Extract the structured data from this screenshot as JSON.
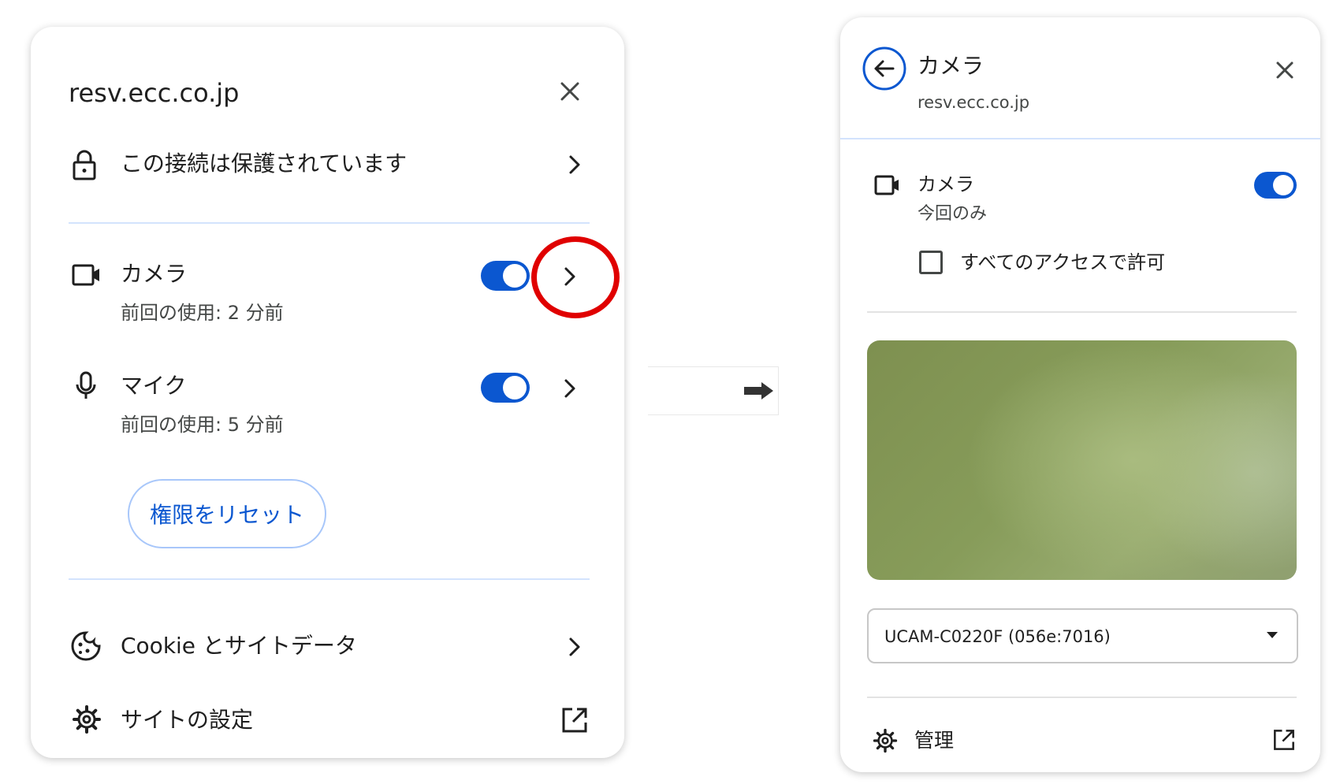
{
  "left": {
    "site": "resv.ecc.co.jp",
    "connection": "この接続は保護されています",
    "camera": {
      "label": "カメラ",
      "status": "前回の使用: 2 分前",
      "enabled": true
    },
    "mic": {
      "label": "マイク",
      "status": "前回の使用: 5 分前",
      "enabled": true
    },
    "reset_button": "権限をリセット",
    "cookies": "Cookie とサイトデータ",
    "site_settings": "サイトの設定"
  },
  "right": {
    "title": "カメラ",
    "site": "resv.ecc.co.jp",
    "camera": {
      "label": "カメラ",
      "status": "今回のみ",
      "enabled": true
    },
    "allow_all_label": "すべてのアクセスで許可",
    "allow_all_checked": false,
    "device": "UCAM-C0220F (056e:7016)",
    "manage": "管理"
  },
  "colors": {
    "accent": "#0b57d0",
    "highlight": "#e00000",
    "divider": "#d3e3fd"
  },
  "icons": [
    "lock-icon",
    "chevron-right-icon",
    "videocam-icon",
    "mic-icon",
    "cookie-icon",
    "gear-icon",
    "open-in-new-icon",
    "close-icon",
    "back-arrow-icon",
    "dropdown-arrow-icon",
    "right-arrow-icon"
  ]
}
